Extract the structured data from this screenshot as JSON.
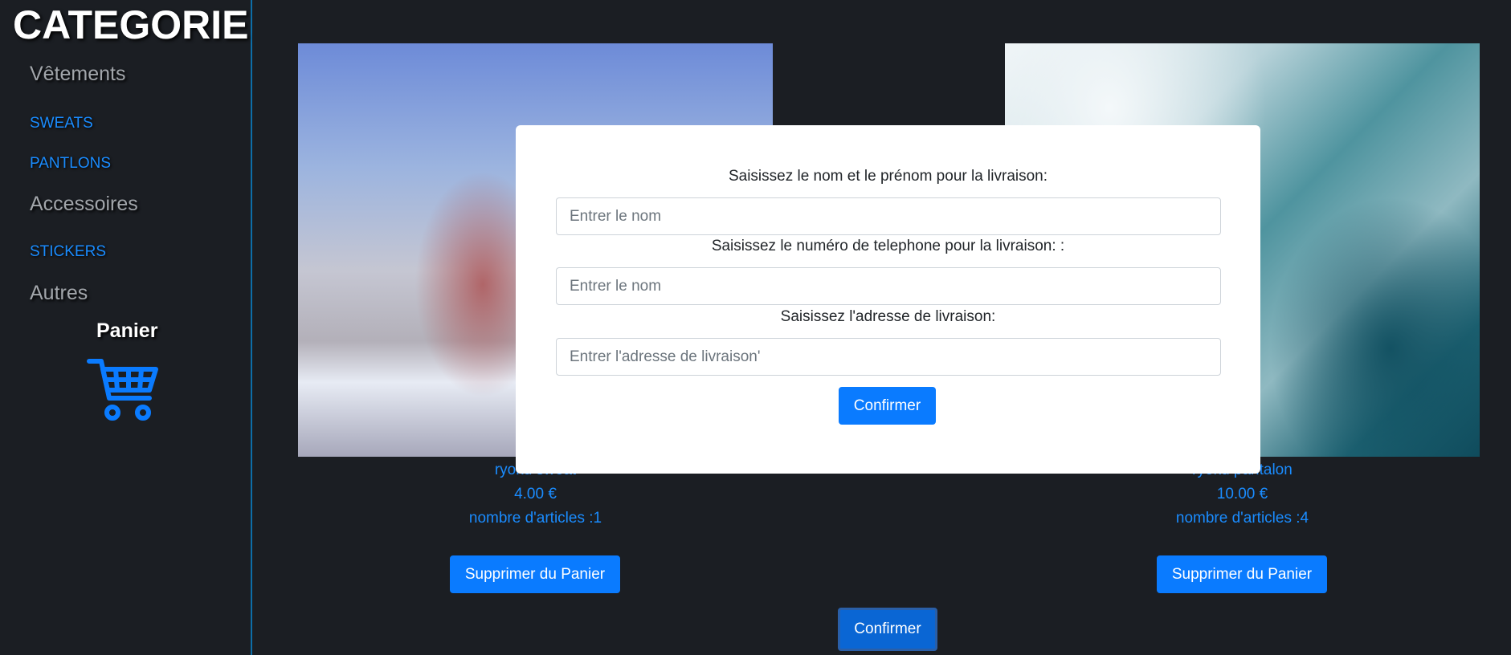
{
  "sidebar": {
    "title": "CATEGORIE",
    "groups": [
      {
        "label": "Vêtements",
        "items": [
          "SWEATS",
          "PANTLONS"
        ]
      },
      {
        "label": "Accessoires",
        "items": [
          "STICKERS"
        ]
      },
      {
        "label": "Autres",
        "items": []
      }
    ],
    "panier_label": "Panier",
    "cart_icon": "shopping-cart-icon",
    "accent_color": "#1a8cff"
  },
  "products": [
    {
      "name": "ryoku sweat",
      "price": "4.00 €",
      "count_text": "nombre d'articles :1",
      "remove_label": "Supprimer du Panier"
    },
    {
      "name": "ryoku pantalon",
      "price": "10.00 €",
      "count_text": "nombre d'articles :4",
      "remove_label": "Supprimer du Panier"
    }
  ],
  "bottom_confirm_label": "Confirmer",
  "modal": {
    "name_label": "Saisissez le nom et le prénom pour la livraison:",
    "name_placeholder": "Entrer le nom",
    "phone_label": "Saisissez le numéro de telephone pour la livraison: :",
    "phone_placeholder": "Entrer le nom",
    "address_label": "Saisissez l'adresse de livraison:",
    "address_placeholder": "Entrer l'adresse de livraison'",
    "confirm_label": "Confirmer"
  }
}
